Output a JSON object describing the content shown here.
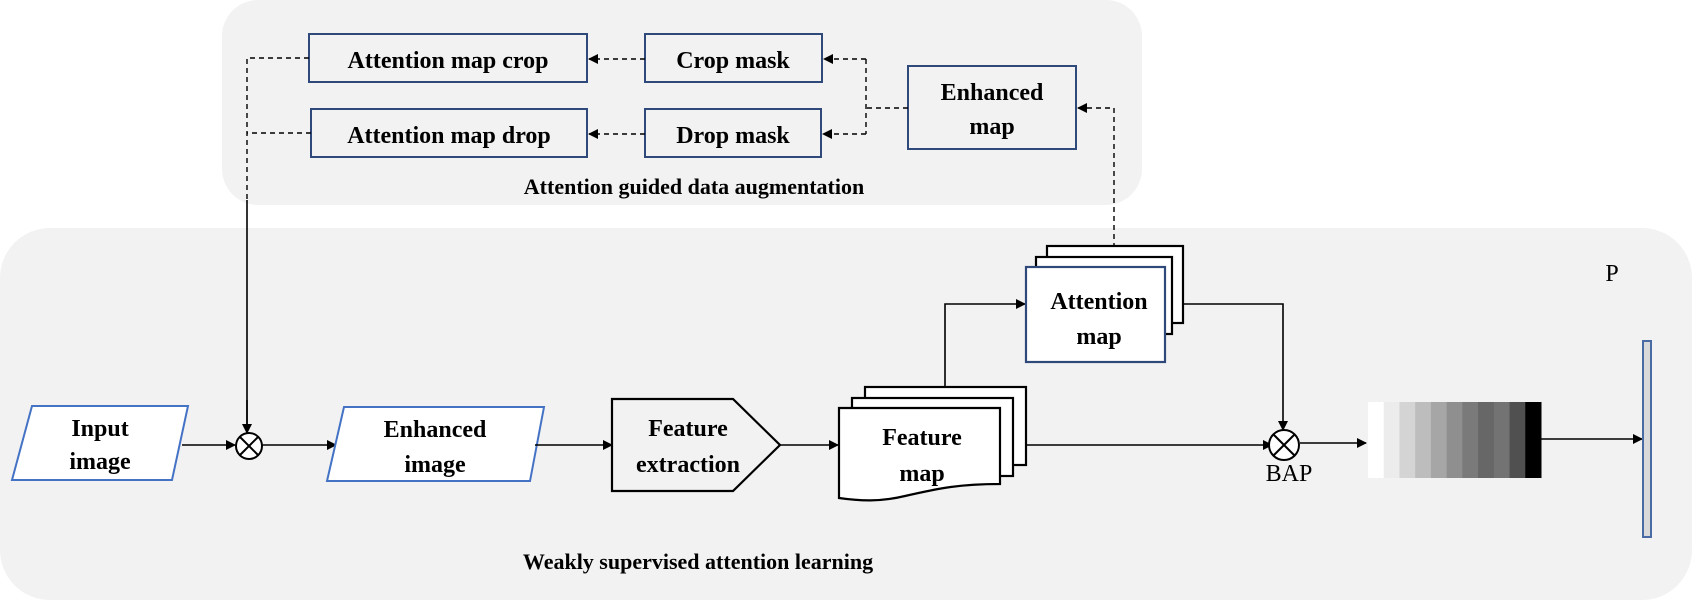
{
  "diagram": {
    "groups": {
      "augmentation": {
        "label": "Attention guided data augmentation"
      },
      "learning": {
        "label": "Weakly supervised attention learning"
      }
    },
    "nodes": {
      "attention_map_crop": "Attention map crop",
      "attention_map_drop": "Attention map drop",
      "crop_mask": "Crop mask",
      "drop_mask": "Drop mask",
      "enhanced_map": {
        "line1": "Enhanced",
        "line2": "map"
      },
      "input_image": {
        "line1": "Input",
        "line2": "image"
      },
      "enhanced_image": {
        "line1": "Enhanced",
        "line2": "image"
      },
      "feature_extraction": {
        "line1": "Feature",
        "line2": "extraction"
      },
      "feature_map": {
        "line1": "Feature",
        "line2": "map"
      },
      "attention_map": {
        "line1": "Attention",
        "line2": "map"
      },
      "bap_label": "BAP",
      "output_label": "P"
    },
    "feature_matrix_shades": [
      "#ffffff",
      "#ececec",
      "#d4d4d4",
      "#bdbdbd",
      "#a6a6a6",
      "#8f8f8f",
      "#7a7a7a",
      "#676767",
      "#737373",
      "#505050",
      "#000000"
    ],
    "edges": [
      {
        "from": "Input image",
        "to": "multiply",
        "style": "solid"
      },
      {
        "from": "multiply",
        "to": "Enhanced image",
        "style": "solid"
      },
      {
        "from": "Enhanced image",
        "to": "Feature extraction",
        "style": "solid"
      },
      {
        "from": "Feature extraction",
        "to": "Feature map",
        "style": "solid"
      },
      {
        "from": "Feature map",
        "to": "Attention map",
        "style": "solid"
      },
      {
        "from": "Feature map",
        "to": "BAP",
        "style": "solid"
      },
      {
        "from": "Attention map",
        "to": "BAP",
        "style": "solid"
      },
      {
        "from": "BAP",
        "to": "feature matrix",
        "style": "solid"
      },
      {
        "from": "feature matrix",
        "to": "P",
        "style": "solid"
      },
      {
        "from": "Attention map",
        "to": "Enhanced map",
        "style": "dashed"
      },
      {
        "from": "Enhanced map",
        "to": "Crop mask",
        "style": "dashed"
      },
      {
        "from": "Enhanced map",
        "to": "Drop mask",
        "style": "dashed"
      },
      {
        "from": "Crop mask",
        "to": "Attention map crop",
        "style": "dashed"
      },
      {
        "from": "Drop mask",
        "to": "Attention map drop",
        "style": "dashed"
      },
      {
        "from": "Attention map crop",
        "to": "multiply",
        "style": "dashed"
      },
      {
        "from": "Attention map drop",
        "to": "multiply",
        "style": "dashed"
      }
    ]
  }
}
